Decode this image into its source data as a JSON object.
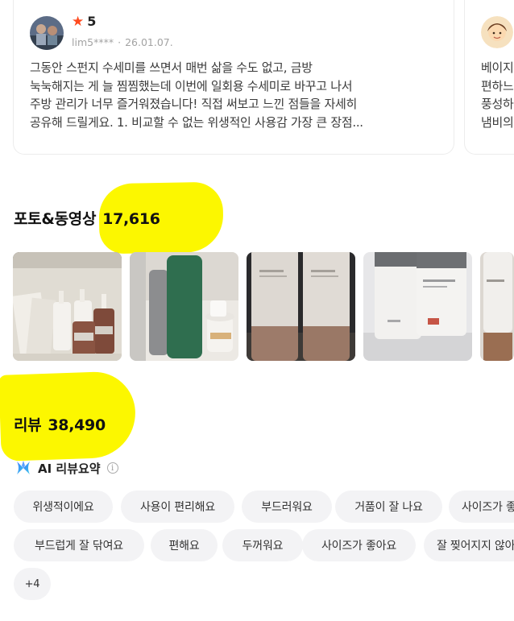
{
  "reviews": [
    {
      "rating": "5",
      "user": "lim5****",
      "date": "26.01.07.",
      "text_lines": [
        "그동안 스펀지 수세미를 쓰면서 매번 삶을 수도 없고, 금방",
        "눅눅해지는 게 늘 찜찜했는데 이번에 일회용 수세미로 바꾸고 나서",
        "주방 관리가 너무 즐거워졌습니다! 직접 써보고 느낀 점들을 자세히",
        "공유해 드릴게요. 1. 비교할 수 없는 위생적인 사용감 가장 큰 장점..."
      ]
    },
    {
      "text_lines": [
        "베이지",
        "편하느",
        "풍성하",
        "냄비의"
      ]
    }
  ],
  "photo_section": {
    "title": "포토&동영상",
    "count": "17,616"
  },
  "review_section": {
    "title": "리뷰",
    "count": "38,490"
  },
  "ai_summary": {
    "label": "AI 리뷰요약",
    "info_symbol": "i",
    "chips": [
      "위생적이에요",
      "사용이 편리해요",
      "부드러워요",
      "거품이 잘 나요",
      "사이즈가 좋아요",
      "부드럽게 잘 닦여요",
      "편해요",
      "두꺼워요",
      "사이즈가 좋아요",
      "잘 찢어지지 않아요",
      "+4"
    ]
  },
  "colors": {
    "star": "#ff4b1f",
    "highlighter": "#fcf700",
    "chip_bg": "#f3f3f5"
  }
}
